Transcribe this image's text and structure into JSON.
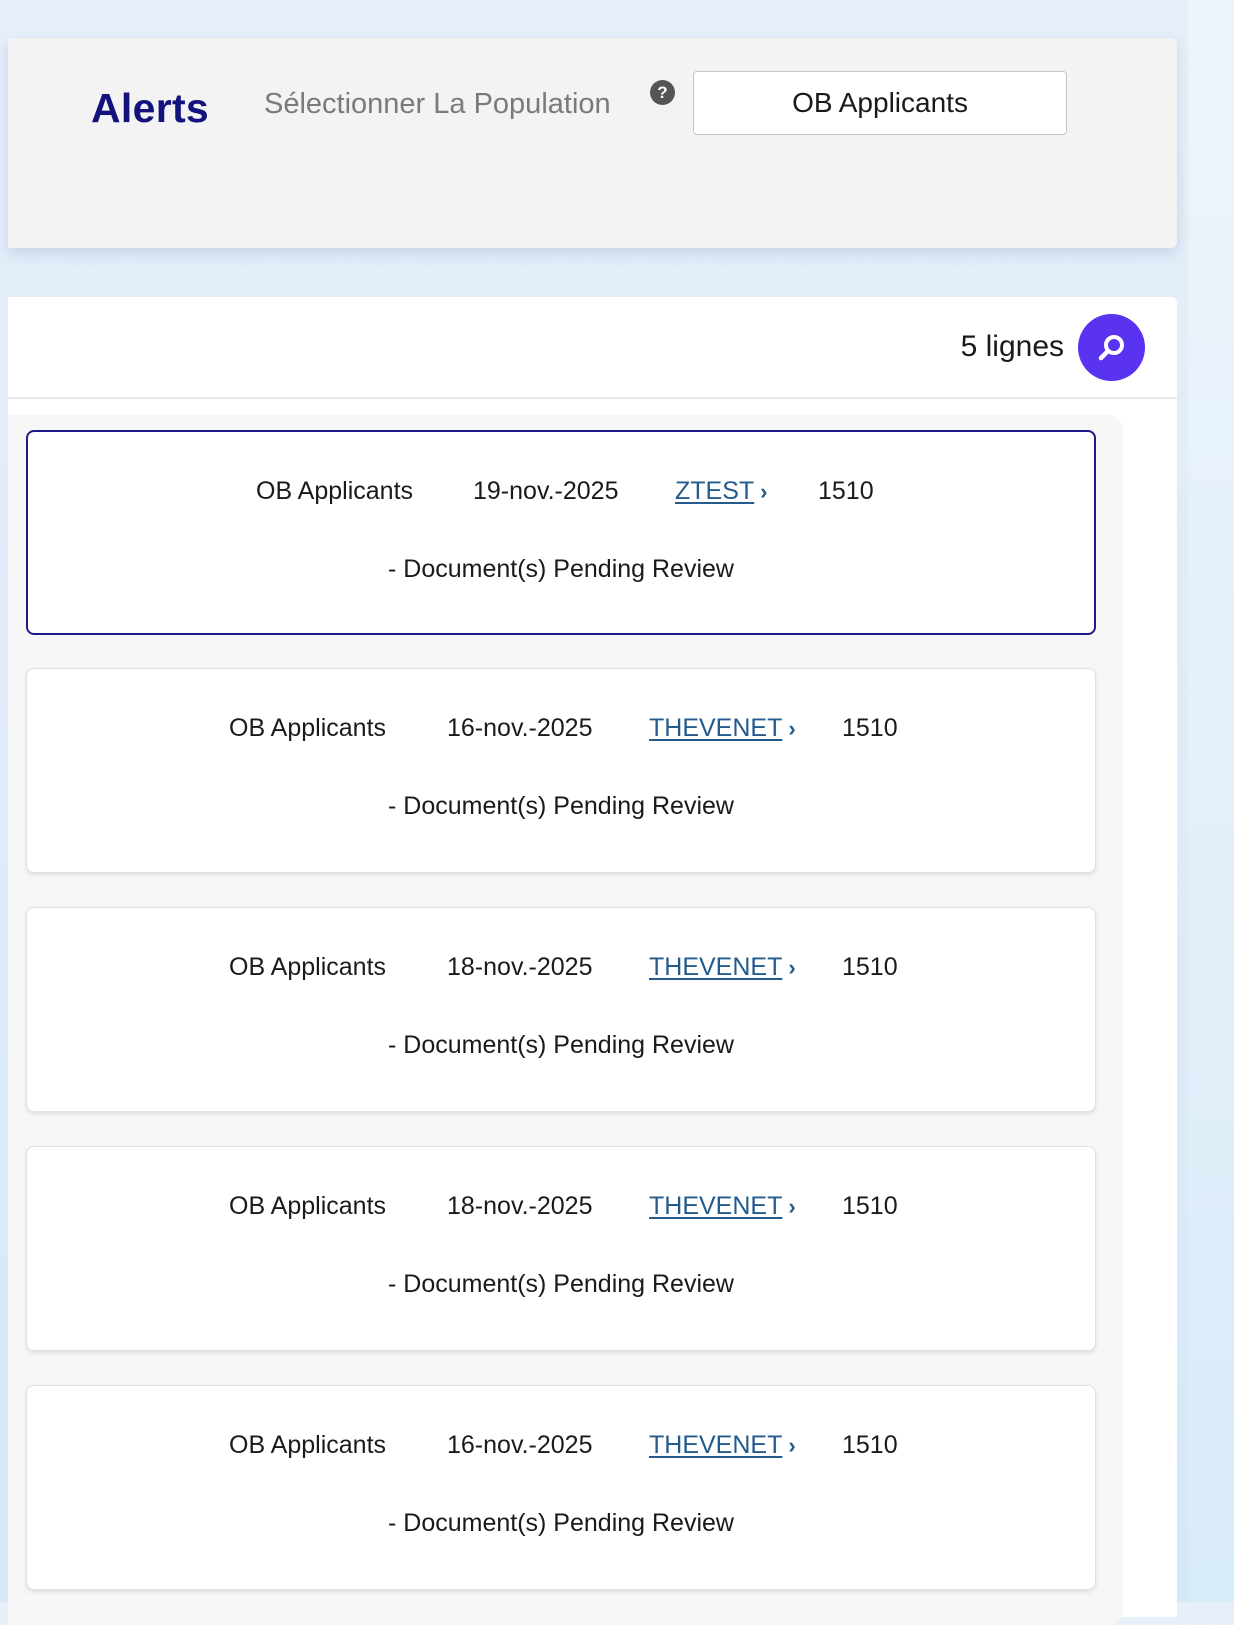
{
  "header": {
    "title": "Alerts",
    "population_label": "Sélectionner La Population",
    "population_value": "OB Applicants"
  },
  "results": {
    "row_count_label": "5 lignes"
  },
  "alerts": [
    {
      "population": "OB Applicants",
      "date": "19-nov.-2025",
      "user": "ZTEST",
      "code": "1510",
      "description": "- Document(s) Pending Review",
      "selected": true
    },
    {
      "population": "OB Applicants",
      "date": "16-nov.-2025",
      "user": "THEVENET",
      "code": "1510",
      "description": "- Document(s) Pending Review",
      "selected": false
    },
    {
      "population": "OB Applicants",
      "date": "18-nov.-2025",
      "user": "THEVENET",
      "code": "1510",
      "description": "- Document(s) Pending Review",
      "selected": false
    },
    {
      "population": "OB Applicants",
      "date": "18-nov.-2025",
      "user": "THEVENET",
      "code": "1510",
      "description": "- Document(s) Pending Review",
      "selected": false
    },
    {
      "population": "OB Applicants",
      "date": "16-nov.-2025",
      "user": "THEVENET",
      "code": "1510",
      "description": "- Document(s) Pending Review",
      "selected": false
    }
  ],
  "icons": {
    "help": "question-circle-icon",
    "search": "search-icon",
    "link_chevron": "chevron-right-icon"
  },
  "colors": {
    "title": "#14127c",
    "accent_button": "#5a33f0",
    "link": "#245b8c",
    "selected_border": "#1f1a8a"
  }
}
